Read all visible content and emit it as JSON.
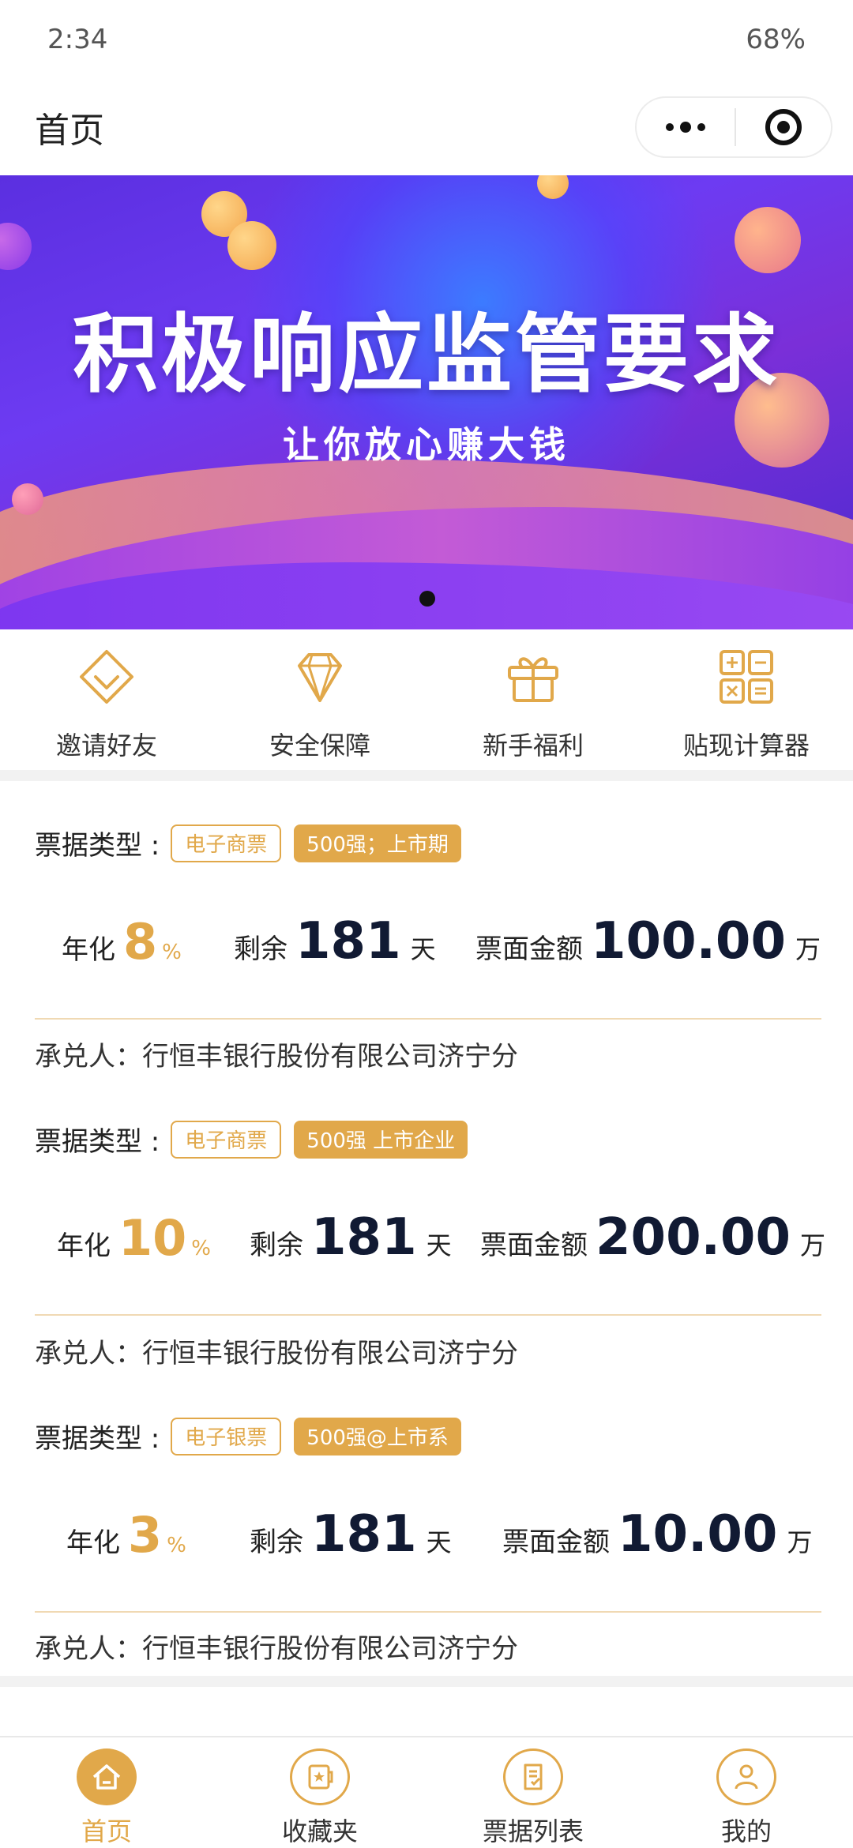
{
  "status_bar": {
    "time": "2:34",
    "battery": "68%"
  },
  "nav": {
    "title": "首页"
  },
  "banner": {
    "title": "积极响应监管要求",
    "subtitle": "让你放心赚大钱"
  },
  "quick_links": [
    {
      "label": "邀请好友",
      "icon": "diamond-heart-icon"
    },
    {
      "label": "安全保障",
      "icon": "diamond-icon"
    },
    {
      "label": "新手福利",
      "icon": "gift-icon"
    },
    {
      "label": "贴现计算器",
      "icon": "calculator-icon"
    }
  ],
  "cards": [
    {
      "type_label": "票据类型 :",
      "tag1": "电子商票",
      "tag2": "500强；上市期",
      "rate_label": "年化",
      "rate": "8",
      "rate_unit": "%",
      "remain_label": "剩余",
      "remain": "181",
      "remain_unit": "天",
      "face_label": "票面金额",
      "face": "100.00",
      "face_unit": "万",
      "acceptor": "承兑人：行恒丰银行股份有限公司济宁分"
    },
    {
      "type_label": "票据类型 :",
      "tag1": "电子商票",
      "tag2": "500强 上市企业",
      "rate_label": "年化",
      "rate": "10",
      "rate_unit": "%",
      "remain_label": "剩余",
      "remain": "181",
      "remain_unit": "天",
      "face_label": "票面金额",
      "face": "200.00",
      "face_unit": "万",
      "acceptor": "承兑人：行恒丰银行股份有限公司济宁分"
    },
    {
      "type_label": "票据类型 :",
      "tag1": "电子银票",
      "tag2": "500强@上市系",
      "rate_label": "年化",
      "rate": "3",
      "rate_unit": "%",
      "remain_label": "剩余",
      "remain": "181",
      "remain_unit": "天",
      "face_label": "票面金额",
      "face": "10.00",
      "face_unit": "万",
      "acceptor": "承兑人：行恒丰银行股份有限公司济宁分"
    }
  ],
  "tabbar": [
    {
      "label": "首页",
      "icon": "home-icon",
      "active": true
    },
    {
      "label": "收藏夹",
      "icon": "favorites-icon",
      "active": false
    },
    {
      "label": "票据列表",
      "icon": "bill-list-icon",
      "active": false
    },
    {
      "label": "我的",
      "icon": "profile-icon",
      "active": false
    }
  ],
  "colors": {
    "accent": "#e1a84a",
    "dark_number": "#111a33",
    "banner_purple": "#6d3bf2"
  }
}
